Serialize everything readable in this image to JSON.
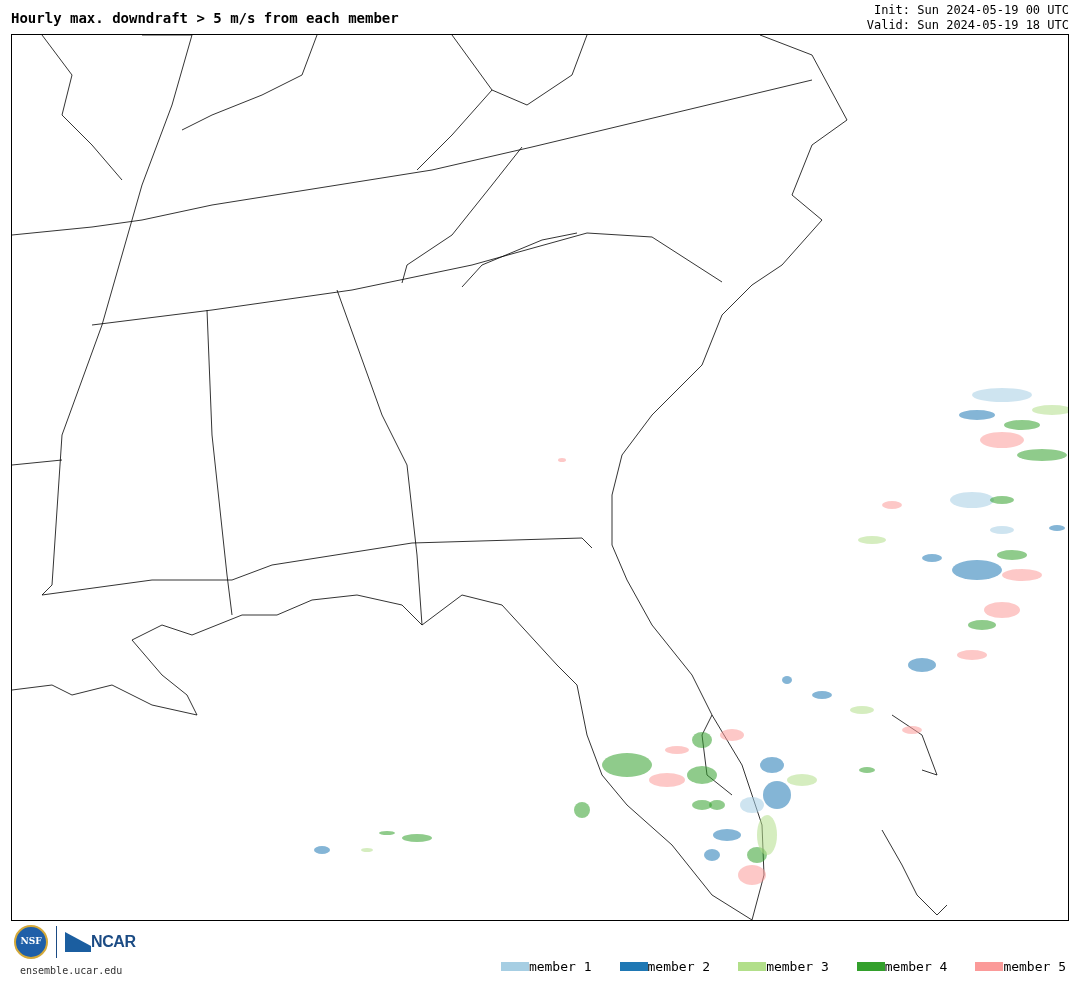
{
  "title": "Hourly max. downdraft > 5 m/s from each member",
  "init": "Init: Sun 2024-05-19 00 UTC",
  "valid": "Valid: Sun 2024-05-19 18 UTC",
  "logos": {
    "nsf": "NSF",
    "ncar": "NCAR"
  },
  "site": "ensemble.ucar.edu",
  "legend": [
    {
      "label": "member 1",
      "color": "#a6cee3"
    },
    {
      "label": "member 2",
      "color": "#1f78b4"
    },
    {
      "label": "member 3",
      "color": "#b2df8a"
    },
    {
      "label": "member 4",
      "color": "#33a02c"
    },
    {
      "label": "member 5",
      "color": "#fb9a99"
    }
  ]
}
